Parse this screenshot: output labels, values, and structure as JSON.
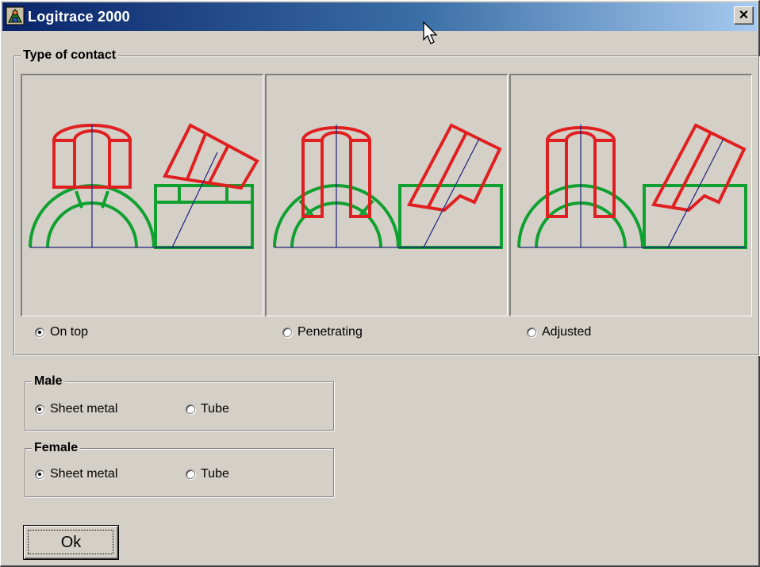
{
  "window": {
    "title": "Logitrace 2000",
    "close_glyph": "×",
    "app_icon": "app-icon"
  },
  "contact_group": {
    "legend": "Type of contact",
    "options": [
      {
        "label": "On top",
        "selected": true
      },
      {
        "label": "Penetrating",
        "selected": false
      },
      {
        "label": "Adjusted",
        "selected": false
      }
    ]
  },
  "male_group": {
    "legend": "Male",
    "options": [
      {
        "label": "Sheet metal",
        "selected": true
      },
      {
        "label": "Tube",
        "selected": false
      }
    ]
  },
  "female_group": {
    "legend": "Female",
    "options": [
      {
        "label": "Sheet metal",
        "selected": true
      },
      {
        "label": "Tube",
        "selected": false
      }
    ]
  },
  "ok_button": {
    "label": "Ok"
  },
  "colors": {
    "male_part": "#e02020",
    "female_part": "#10a030",
    "axis": "#20207a",
    "titlebar_start": "#0a246a",
    "titlebar_end": "#a6caf0"
  }
}
